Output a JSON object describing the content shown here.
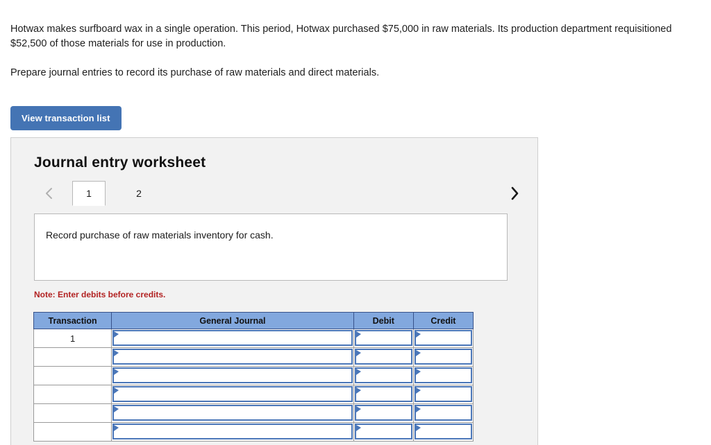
{
  "problem": {
    "paragraph_1": "Hotwax makes surfboard wax in a single operation. This period, Hotwax purchased $75,000 in raw materials. Its production department requisitioned $52,500 of those materials for use in production.",
    "paragraph_2": "Prepare journal entries to record its purchase of raw materials and direct materials."
  },
  "toolbar": {
    "view_transaction_list_label": "View transaction list"
  },
  "worksheet": {
    "title": "Journal entry worksheet",
    "tabs": [
      {
        "label": "1",
        "active": true
      },
      {
        "label": "2",
        "active": false
      }
    ],
    "prev_arrow": "‹",
    "next_arrow": "›",
    "description": "Record purchase of raw materials inventory for cash.",
    "note": "Note: Enter debits before credits."
  },
  "table": {
    "headers": [
      "Transaction",
      "General Journal",
      "Debit",
      "Credit"
    ],
    "rows": [
      {
        "transaction": "1",
        "general_journal": "",
        "debit": "",
        "credit": ""
      },
      {
        "transaction": "",
        "general_journal": "",
        "debit": "",
        "credit": ""
      },
      {
        "transaction": "",
        "general_journal": "",
        "debit": "",
        "credit": ""
      },
      {
        "transaction": "",
        "general_journal": "",
        "debit": "",
        "credit": ""
      },
      {
        "transaction": "",
        "general_journal": "",
        "debit": "",
        "credit": ""
      },
      {
        "transaction": "",
        "general_journal": "",
        "debit": "",
        "credit": ""
      }
    ]
  },
  "colors": {
    "button_blue": "#4474b4",
    "header_blue": "#82a8de",
    "input_border_blue": "#4a76b8",
    "note_red": "#b22222",
    "panel_gray": "#f2f2f2"
  }
}
